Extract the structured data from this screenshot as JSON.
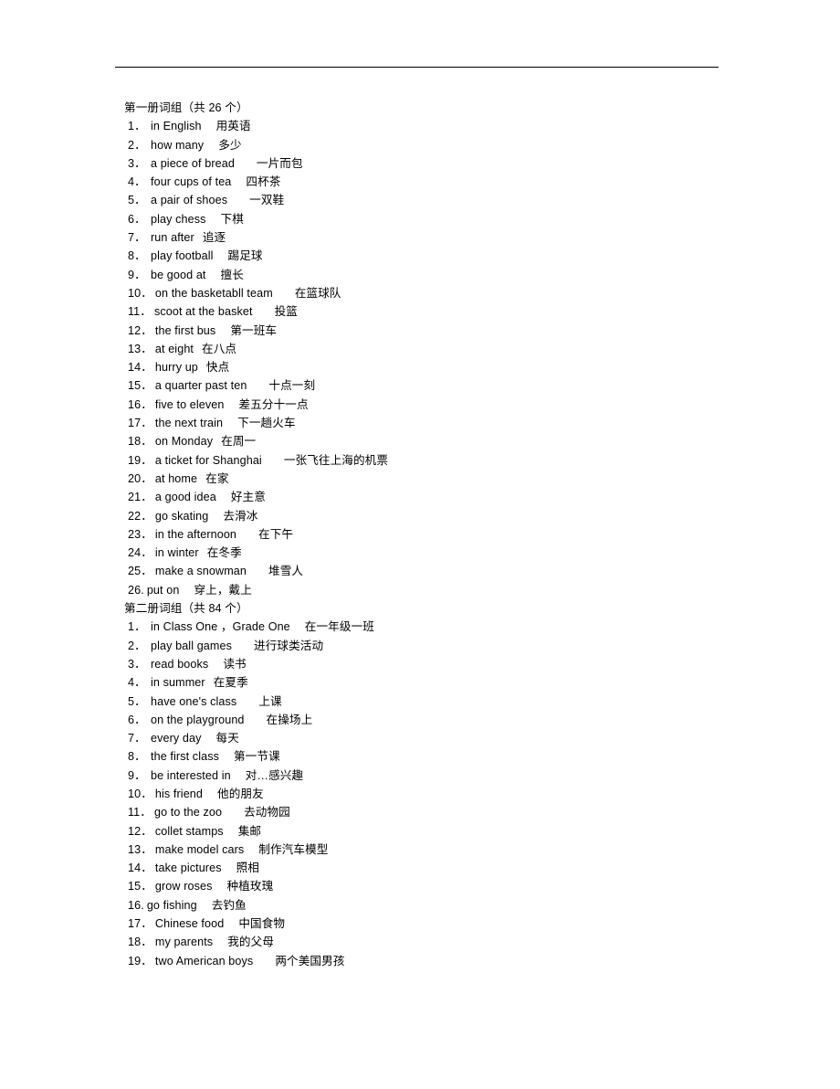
{
  "document": {
    "title": "第一册词组",
    "rule_visible": true
  },
  "sections": [
    {
      "heading": "第一册词组（共 26 个）",
      "items": [
        {
          "num": "1．",
          "en": "in English",
          "cn": "用英语",
          "gap": "md",
          "compact": false
        },
        {
          "num": "2．",
          "en": "how many",
          "cn": "多少",
          "gap": "md",
          "compact": false
        },
        {
          "num": "3．",
          "en": "a piece of bread",
          "cn": "一片而包",
          "gap": "lg",
          "compact": false
        },
        {
          "num": "4．",
          "en": "four cups of tea",
          "cn": "四杯茶",
          "gap": "md",
          "compact": false
        },
        {
          "num": "5．",
          "en": "a pair of shoes",
          "cn": "一双鞋",
          "gap": "lg",
          "compact": false
        },
        {
          "num": "6．",
          "en": "play chess",
          "cn": "下棋",
          "gap": "md",
          "compact": false
        },
        {
          "num": "7．",
          "en": "run after",
          "cn": "追逐",
          "gap": "sm",
          "compact": false
        },
        {
          "num": "8．",
          "en": "play football",
          "cn": "踢足球",
          "gap": "md",
          "compact": false
        },
        {
          "num": "9．",
          "en": "be good at",
          "cn": "擅长",
          "gap": "md",
          "compact": false
        },
        {
          "num": "10．",
          "en": "on the basketabll team",
          "cn": "在篮球队",
          "gap": "lg",
          "compact": false
        },
        {
          "num": "11．",
          "en": "scoot at the basket",
          "cn": "投篮",
          "gap": "lg",
          "compact": false
        },
        {
          "num": "12．",
          "en": "the first bus",
          "cn": "第一班车",
          "gap": "md",
          "compact": false
        },
        {
          "num": "13．",
          "en": "at eight",
          "cn": "在八点",
          "gap": "sm",
          "compact": false
        },
        {
          "num": "14．",
          "en": "hurry up",
          "cn": "快点",
          "gap": "sm",
          "compact": false
        },
        {
          "num": "15．",
          "en": "a quarter past ten",
          "cn": "十点一刻",
          "gap": "lg",
          "compact": false
        },
        {
          "num": "16．",
          "en": "five to eleven",
          "cn": "差五分十一点",
          "gap": "md",
          "compact": false
        },
        {
          "num": "17．",
          "en": "the next train",
          "cn": "下一趟火车",
          "gap": "md",
          "compact": false
        },
        {
          "num": "18．",
          "en": "on Monday",
          "cn": "在周一",
          "gap": "sm",
          "compact": false
        },
        {
          "num": "19．",
          "en": "a ticket for Shanghai",
          "cn": "一张飞往上海的机票",
          "gap": "lg",
          "compact": false
        },
        {
          "num": "20．",
          "en": "at home",
          "cn": "在家",
          "gap": "sm",
          "compact": false
        },
        {
          "num": "21．",
          "en": "a good idea",
          "cn": "好主意",
          "gap": "md",
          "compact": false
        },
        {
          "num": "22．",
          "en": "go skating",
          "cn": "去滑冰",
          "gap": "md",
          "compact": false
        },
        {
          "num": "23．",
          "en": "in the afternoon",
          "cn": "在下午",
          "gap": "lg",
          "compact": false
        },
        {
          "num": "24．",
          "en": "in winter",
          "cn": "在冬季",
          "gap": "sm",
          "compact": false
        },
        {
          "num": "25．",
          "en": "make a snowman",
          "cn": "堆雪人",
          "gap": "lg",
          "compact": false
        },
        {
          "num": "26.",
          "en": "put on",
          "cn": "穿上，戴上",
          "gap": "md",
          "compact": true
        }
      ]
    },
    {
      "heading": "第二册词组（共 84 个）",
      "items": [
        {
          "num": "1．",
          "en": "in Class One ，Grade One",
          "cn": "在一年级一班",
          "gap": "md",
          "compact": false
        },
        {
          "num": "2．",
          "en": "play ball games",
          "cn": "进行球类活动",
          "gap": "lg",
          "compact": false
        },
        {
          "num": "3．",
          "en": "read books",
          "cn": "读书",
          "gap": "md",
          "compact": false
        },
        {
          "num": "4．",
          "en": "in summer",
          "cn": "在夏季",
          "gap": "sm",
          "compact": false
        },
        {
          "num": "5．",
          "en": "have one's class",
          "cn": "上课",
          "gap": "lg",
          "compact": false
        },
        {
          "num": "6．",
          "en": "on the playground",
          "cn": "在操场上",
          "gap": "lg",
          "compact": false
        },
        {
          "num": "7．",
          "en": "every day",
          "cn": "每天",
          "gap": "md",
          "compact": false
        },
        {
          "num": "8．",
          "en": "the first class",
          "cn": "第一节课",
          "gap": "md",
          "compact": false
        },
        {
          "num": "9．",
          "en": "be interested in",
          "cn": "对…感兴趣",
          "gap": "md",
          "compact": false
        },
        {
          "num": "10．",
          "en": "his friend",
          "cn": "他的朋友",
          "gap": "md",
          "compact": false
        },
        {
          "num": "11．",
          "en": "go to the zoo",
          "cn": "去动物园",
          "gap": "lg",
          "compact": false
        },
        {
          "num": "12．",
          "en": "collet stamps",
          "cn": "集邮",
          "gap": "md",
          "compact": false
        },
        {
          "num": "13．",
          "en": "make model cars",
          "cn": "制作汽车模型",
          "gap": "md",
          "compact": false
        },
        {
          "num": "14．",
          "en": "take pictures",
          "cn": "照相",
          "gap": "md",
          "compact": false
        },
        {
          "num": "15．",
          "en": "grow roses",
          "cn": "种植玫瑰",
          "gap": "md",
          "compact": false
        },
        {
          "num": "16.",
          "en": "go fishing",
          "cn": "去钓鱼",
          "gap": "md",
          "compact": true
        },
        {
          "num": "17．",
          "en": "Chinese food",
          "cn": "中国食物",
          "gap": "md",
          "compact": false
        },
        {
          "num": "18．",
          "en": "my parents",
          "cn": "我的父母",
          "gap": "md",
          "compact": false
        },
        {
          "num": "19．",
          "en": "two American boys",
          "cn": "两个美国男孩",
          "gap": "lg",
          "compact": false
        }
      ]
    }
  ]
}
